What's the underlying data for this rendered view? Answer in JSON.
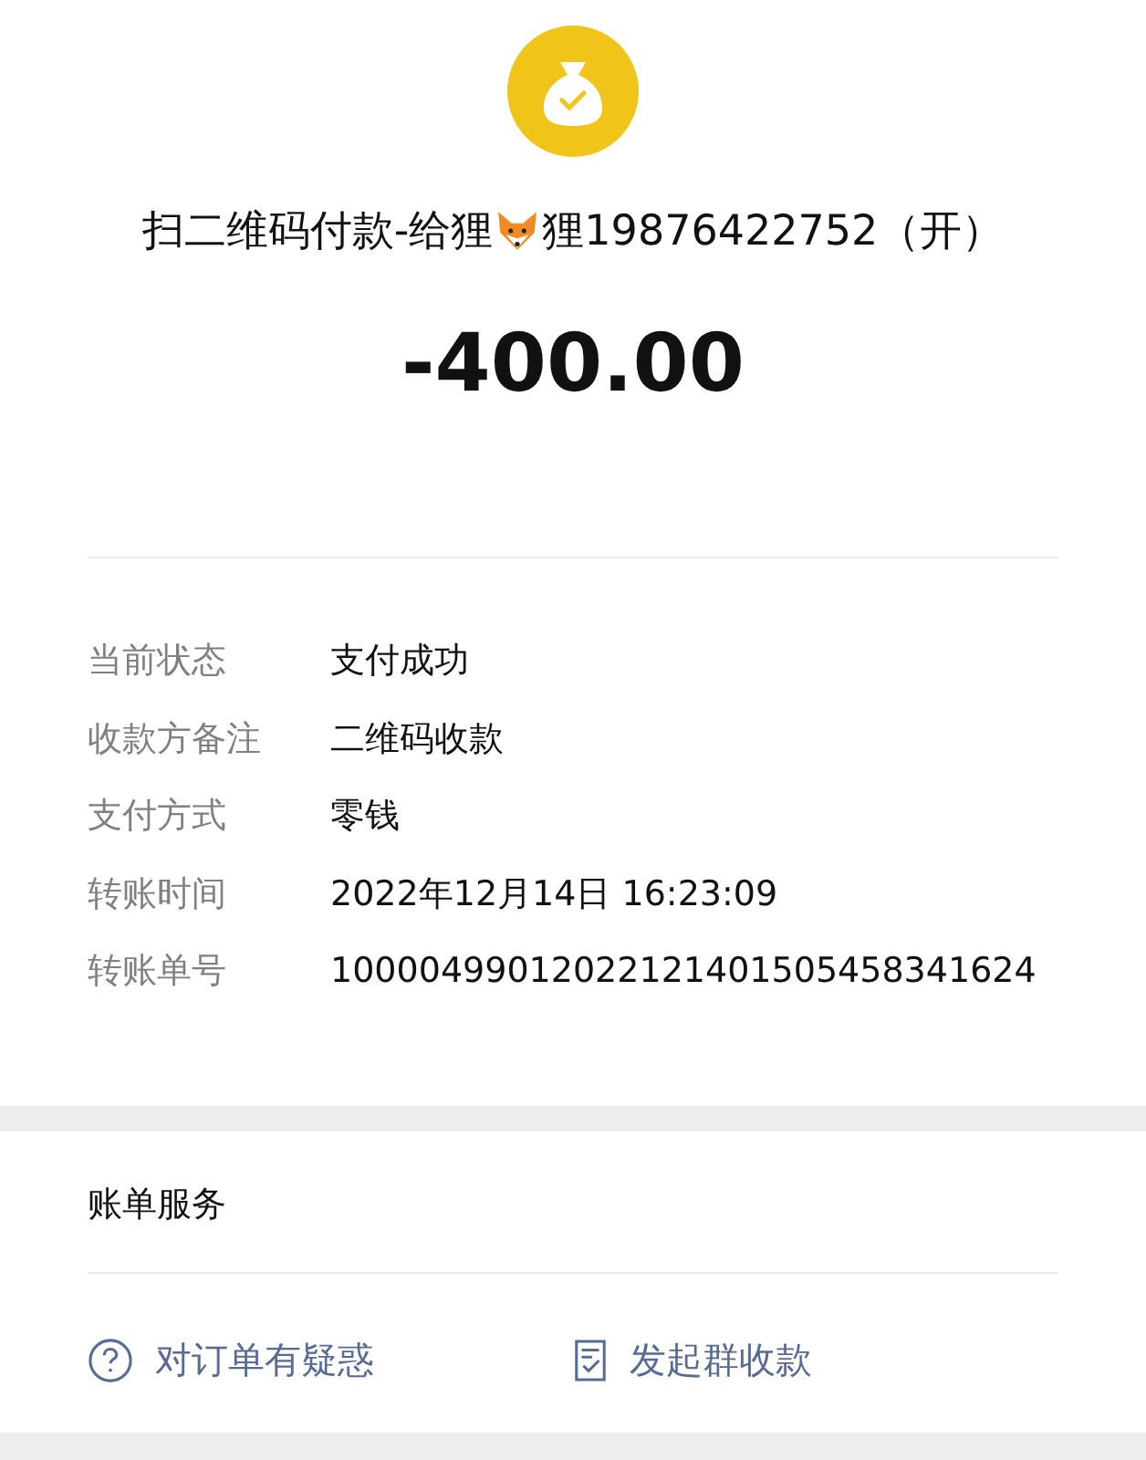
{
  "header": {
    "title_before_icon": "扫二维码付款-给狸",
    "title_after_icon": "狸19876422752（开）",
    "amount": "-400.00"
  },
  "details": [
    {
      "label": "当前状态",
      "value": "支付成功"
    },
    {
      "label": "收款方备注",
      "value": "二维码收款"
    },
    {
      "label": "支付方式",
      "value": "零钱"
    },
    {
      "label": "转账时间",
      "value": "2022年12月14日 16:23:09"
    },
    {
      "label": "转账单号",
      "value": "10000499012022121401505458341624"
    }
  ],
  "services": {
    "title": "账单服务",
    "actions": [
      {
        "kind": "question",
        "label": "对订单有疑惑"
      },
      {
        "kind": "group",
        "label": "发起群收款"
      }
    ]
  }
}
